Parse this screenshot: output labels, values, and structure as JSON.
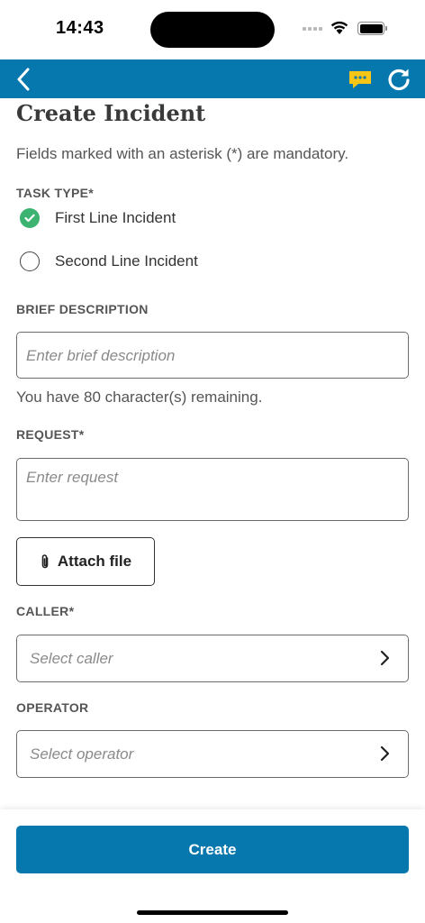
{
  "status_bar": {
    "time": "14:43"
  },
  "header": {
    "back_icon": "chevron-left-icon",
    "chat_icon": "chat-bubble-icon",
    "refresh_icon": "refresh-icon",
    "colors": {
      "bar": "#0678ad",
      "chat_badge": "#f5c518"
    }
  },
  "page": {
    "title": "Create Incident",
    "hint": "Fields marked with an asterisk (*) are mandatory."
  },
  "task_type": {
    "label": "TASK TYPE*",
    "options": [
      {
        "label": "First Line Incident",
        "selected": true
      },
      {
        "label": "Second Line Incident",
        "selected": false
      }
    ]
  },
  "brief_description": {
    "label": "BRIEF DESCRIPTION",
    "placeholder": "Enter brief description",
    "counter": "You have 80 character(s) remaining."
  },
  "request": {
    "label": "REQUEST*",
    "placeholder": "Enter request"
  },
  "attach": {
    "label": "Attach file",
    "icon": "paperclip-icon"
  },
  "caller": {
    "label": "CALLER*",
    "placeholder": "Select caller"
  },
  "operator": {
    "label": "OPERATOR",
    "placeholder": "Select operator"
  },
  "footer": {
    "create_label": "Create"
  },
  "colors": {
    "primary": "#0678ad",
    "success": "#3cb371"
  }
}
